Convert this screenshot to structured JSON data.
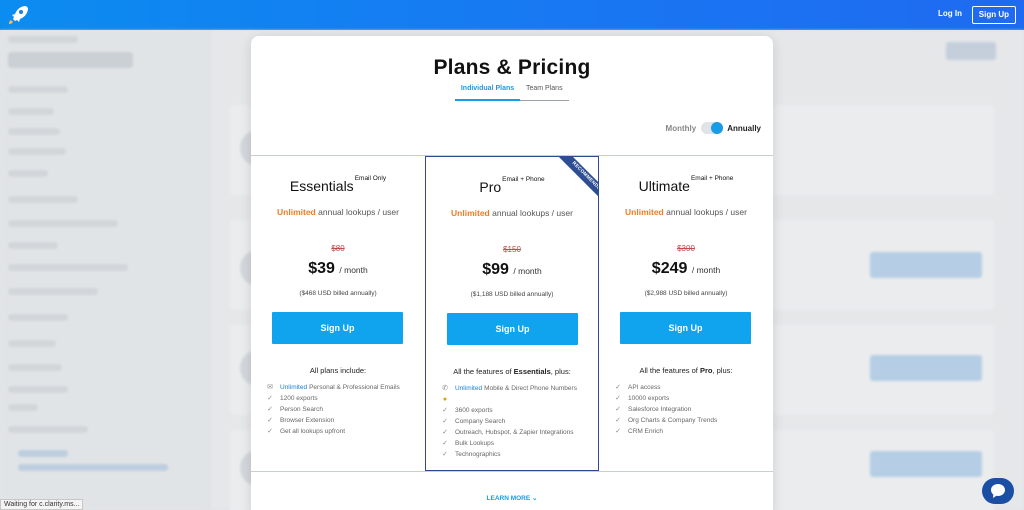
{
  "header": {
    "login_label": "Log In",
    "signup_label": "Sign Up"
  },
  "modal": {
    "title": "Plans & Pricing",
    "tabs": [
      "Individual Plans",
      "Team Plans"
    ],
    "billing": {
      "monthly_label": "Monthly",
      "annually_label": "Annually",
      "selected": "Annually"
    },
    "learn_more": "LEARN MORE"
  },
  "plans": [
    {
      "name": "Essentials",
      "tag": "Email Only",
      "lookups_highlight": "Unlimited",
      "lookups_rest": "annual lookups / user",
      "old_price": "$80",
      "price": "$39",
      "per": "/ month",
      "billed": "($468 USD billed annually)",
      "button": "Sign Up",
      "features_head": "All plans include:",
      "features": [
        {
          "icon": "email-icon",
          "highlight": "Unlimited",
          "text": "Personal & Professional Emails"
        },
        {
          "icon": "check-icon",
          "highlight": "",
          "text": "1200 exports"
        },
        {
          "icon": "check-icon",
          "highlight": "",
          "text": "Person Search"
        },
        {
          "icon": "check-icon",
          "highlight": "",
          "text": "Browser Extension"
        },
        {
          "icon": "check-icon",
          "highlight": "",
          "text": "Get all lookups upfront"
        }
      ]
    },
    {
      "name": "Pro",
      "tag": "Email + Phone",
      "ribbon": "RECOMMENDED",
      "lookups_highlight": "Unlimited",
      "lookups_rest": "annual lookups / user",
      "old_price": "$150",
      "price": "$99",
      "per": "/ month",
      "billed": "($1,188 USD billed annually)",
      "button": "Sign Up",
      "features_head_pre": "All the features of ",
      "features_head_bold": "Essentials",
      "features_head_post": ", plus:",
      "features": [
        {
          "icon": "phone-icon",
          "highlight": "Unlimited",
          "text": "Mobile & Direct Phone Numbers"
        },
        {
          "icon": "emoji-icon",
          "highlight": "",
          "text": ""
        },
        {
          "icon": "check-icon",
          "highlight": "",
          "text": "3600 exports"
        },
        {
          "icon": "check-icon",
          "highlight": "",
          "text": "Company Search"
        },
        {
          "icon": "check-icon",
          "highlight": "",
          "text": "Outreach, Hubspot, & Zapier Integrations"
        },
        {
          "icon": "check-icon",
          "highlight": "",
          "text": "Bulk Lookups"
        },
        {
          "icon": "check-icon",
          "highlight": "",
          "text": "Technographics"
        }
      ]
    },
    {
      "name": "Ultimate",
      "tag": "Email + Phone",
      "lookups_highlight": "Unlimited",
      "lookups_rest": "annual lookups / user",
      "old_price": "$300",
      "price": "$249",
      "per": "/ month",
      "billed": "($2,988 USD billed annually)",
      "button": "Sign Up",
      "features_head_pre": "All the features of ",
      "features_head_bold": "Pro",
      "features_head_post": ", plus:",
      "features": [
        {
          "icon": "check-icon",
          "highlight": "",
          "text": "API access"
        },
        {
          "icon": "check-icon",
          "highlight": "",
          "text": "10000 exports"
        },
        {
          "icon": "check-icon",
          "highlight": "",
          "text": "Salesforce Integration"
        },
        {
          "icon": "check-icon",
          "highlight": "",
          "text": "Org Charts & Company Trends"
        },
        {
          "icon": "check-icon",
          "highlight": "",
          "text": "CRM Enrich"
        }
      ]
    }
  ],
  "status_bar": "Waiting for c.clarity.ms..."
}
